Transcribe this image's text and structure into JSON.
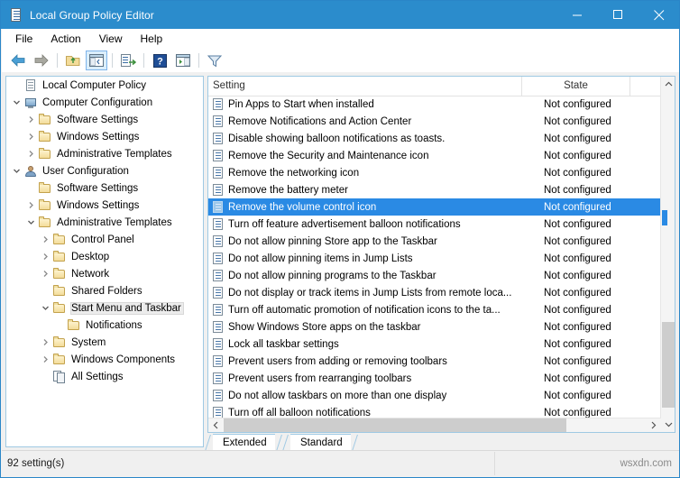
{
  "window": {
    "title": "Local Group Policy Editor",
    "title_icon": "policy-document-icon",
    "minimize_label": "Minimize",
    "maximize_label": "Maximize",
    "close_label": "Close",
    "titlebar_color": "#2b8ccc"
  },
  "menu": {
    "items": [
      {
        "label": "File"
      },
      {
        "label": "Action"
      },
      {
        "label": "View"
      },
      {
        "label": "Help"
      }
    ]
  },
  "toolbar": {
    "buttons": [
      {
        "name": "back-icon",
        "title": "Back"
      },
      {
        "name": "forward-icon",
        "title": "Forward"
      },
      {
        "name": "up-one-level-icon",
        "title": "Up one level"
      },
      {
        "name": "show-hide-console-tree-icon",
        "title": "Show/Hide Console Tree",
        "pressed": true
      },
      {
        "name": "export-list-icon",
        "title": "Export List"
      },
      {
        "name": "help-icon",
        "title": "Help"
      },
      {
        "name": "show-hide-action-pane-icon",
        "title": "Show/Hide Action Pane"
      },
      {
        "name": "filter-icon",
        "title": "Filter"
      }
    ]
  },
  "tree": {
    "items": [
      {
        "label": "Local Computer Policy",
        "indent": 0,
        "twisty": "none",
        "icon": "policy-document-icon",
        "selected": false
      },
      {
        "label": "Computer Configuration",
        "indent": 0,
        "twisty": "expanded",
        "icon": "computer-icon",
        "selected": false
      },
      {
        "label": "Software Settings",
        "indent": 1,
        "twisty": "collapsed",
        "icon": "folder-icon",
        "selected": false
      },
      {
        "label": "Windows Settings",
        "indent": 1,
        "twisty": "collapsed",
        "icon": "folder-icon",
        "selected": false
      },
      {
        "label": "Administrative Templates",
        "indent": 1,
        "twisty": "collapsed",
        "icon": "folder-icon",
        "selected": false
      },
      {
        "label": "User Configuration",
        "indent": 0,
        "twisty": "expanded",
        "icon": "user-icon",
        "selected": false
      },
      {
        "label": "Software Settings",
        "indent": 1,
        "twisty": "none",
        "icon": "folder-icon",
        "selected": false
      },
      {
        "label": "Windows Settings",
        "indent": 1,
        "twisty": "collapsed",
        "icon": "folder-icon",
        "selected": false
      },
      {
        "label": "Administrative Templates",
        "indent": 1,
        "twisty": "expanded",
        "icon": "folder-icon",
        "selected": false
      },
      {
        "label": "Control Panel",
        "indent": 2,
        "twisty": "collapsed",
        "icon": "folder-icon",
        "selected": false
      },
      {
        "label": "Desktop",
        "indent": 2,
        "twisty": "collapsed",
        "icon": "folder-icon",
        "selected": false
      },
      {
        "label": "Network",
        "indent": 2,
        "twisty": "collapsed",
        "icon": "folder-icon",
        "selected": false
      },
      {
        "label": "Shared Folders",
        "indent": 2,
        "twisty": "none",
        "icon": "folder-icon",
        "selected": false
      },
      {
        "label": "Start Menu and Taskbar",
        "indent": 2,
        "twisty": "expanded",
        "icon": "folder-icon",
        "selected": true
      },
      {
        "label": "Notifications",
        "indent": 3,
        "twisty": "none",
        "icon": "folder-icon",
        "selected": false
      },
      {
        "label": "System",
        "indent": 2,
        "twisty": "collapsed",
        "icon": "folder-icon",
        "selected": false
      },
      {
        "label": "Windows Components",
        "indent": 2,
        "twisty": "collapsed",
        "icon": "folder-icon",
        "selected": false
      },
      {
        "label": "All Settings",
        "indent": 2,
        "twisty": "none",
        "icon": "all-settings-icon",
        "selected": false
      }
    ]
  },
  "list": {
    "columns": [
      {
        "key": "setting",
        "label": "Setting"
      },
      {
        "key": "state",
        "label": "State"
      },
      {
        "key": "comment",
        "label": ""
      }
    ],
    "rows": [
      {
        "setting": "Pin Apps to Start when installed",
        "state": "Not configured",
        "selected": false
      },
      {
        "setting": "Remove Notifications and Action Center",
        "state": "Not configured",
        "selected": false
      },
      {
        "setting": "Disable showing balloon notifications as toasts.",
        "state": "Not configured",
        "selected": false
      },
      {
        "setting": "Remove the Security and Maintenance icon",
        "state": "Not configured",
        "selected": false
      },
      {
        "setting": "Remove the networking icon",
        "state": "Not configured",
        "selected": false
      },
      {
        "setting": "Remove the battery meter",
        "state": "Not configured",
        "selected": false
      },
      {
        "setting": "Remove the volume control icon",
        "state": "Not configured",
        "selected": true
      },
      {
        "setting": "Turn off feature advertisement balloon notifications",
        "state": "Not configured",
        "selected": false
      },
      {
        "setting": "Do not allow pinning Store app to the Taskbar",
        "state": "Not configured",
        "selected": false
      },
      {
        "setting": "Do not allow pinning items in Jump Lists",
        "state": "Not configured",
        "selected": false
      },
      {
        "setting": "Do not allow pinning programs to the Taskbar",
        "state": "Not configured",
        "selected": false
      },
      {
        "setting": "Do not display or track items in Jump Lists from remote loca...",
        "state": "Not configured",
        "selected": false
      },
      {
        "setting": "Turn off automatic promotion of notification icons to the ta...",
        "state": "Not configured",
        "selected": false
      },
      {
        "setting": "Show Windows Store apps on the taskbar",
        "state": "Not configured",
        "selected": false
      },
      {
        "setting": "Lock all taskbar settings",
        "state": "Not configured",
        "selected": false
      },
      {
        "setting": "Prevent users from adding or removing toolbars",
        "state": "Not configured",
        "selected": false
      },
      {
        "setting": "Prevent users from rearranging toolbars",
        "state": "Not configured",
        "selected": false
      },
      {
        "setting": "Do not allow taskbars on more than one display",
        "state": "Not configured",
        "selected": false
      },
      {
        "setting": "Turn off all balloon notifications",
        "state": "Not configured",
        "selected": false
      }
    ],
    "selection_accent": "#2a8ae4"
  },
  "tabs": {
    "items": [
      {
        "label": "Extended",
        "active": false
      },
      {
        "label": "Standard",
        "active": true
      }
    ]
  },
  "status": {
    "text": "92 setting(s)",
    "watermark": "wsxdn.com"
  }
}
